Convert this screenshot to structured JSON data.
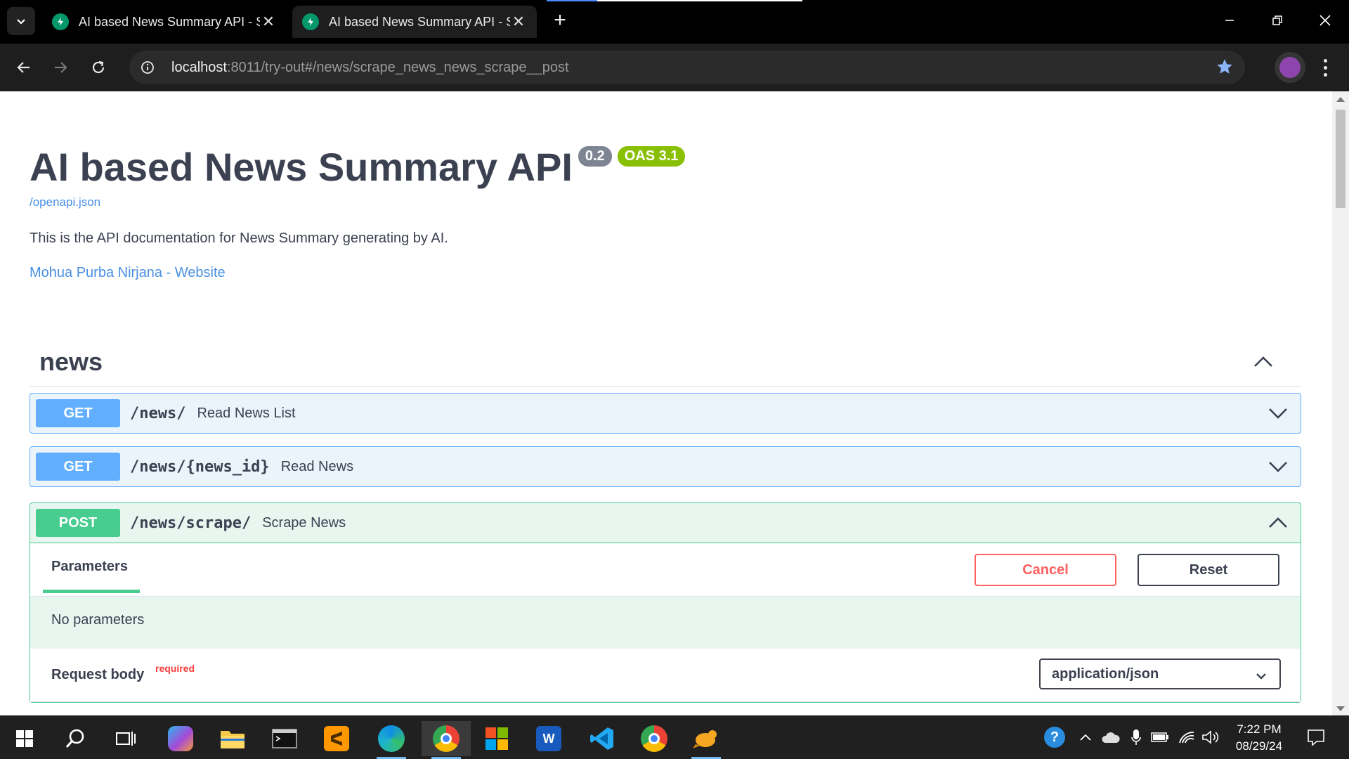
{
  "browser": {
    "tabs": [
      {
        "title": "AI based News Summary API - S"
      },
      {
        "title": "AI based News Summary API - S"
      }
    ],
    "url_host": "localhost",
    "url_path": ":8011/try-out#/news/scrape_news_news_scrape__post"
  },
  "page": {
    "title": "AI based News Summary API",
    "version_badge": "0.2",
    "oas_badge": "OAS 3.1",
    "spec_link": "/openapi.json",
    "description": "This is the API documentation for News Summary generating by AI.",
    "contact_link": "Mohua Purba Nirjana - Website",
    "tag": {
      "name": "news",
      "operations": [
        {
          "method": "GET",
          "path": "/news/",
          "summary": "Read News List"
        },
        {
          "method": "GET",
          "path": "/news/{news_id}",
          "summary": "Read News"
        },
        {
          "method": "POST",
          "path": "/news/scrape/",
          "summary": "Scrape News"
        }
      ]
    },
    "expanded": {
      "params_tab": "Parameters",
      "cancel_label": "Cancel",
      "reset_label": "Reset",
      "no_params": "No parameters",
      "request_body_label": "Request body",
      "required_label": "required",
      "content_type": "application/json"
    }
  },
  "taskbar": {
    "time": "7:22 PM",
    "date": "08/29/24"
  },
  "colors": {
    "get": "#61affe",
    "post": "#49cc90",
    "cancel": "#ff6060",
    "link": "#4990e2"
  }
}
